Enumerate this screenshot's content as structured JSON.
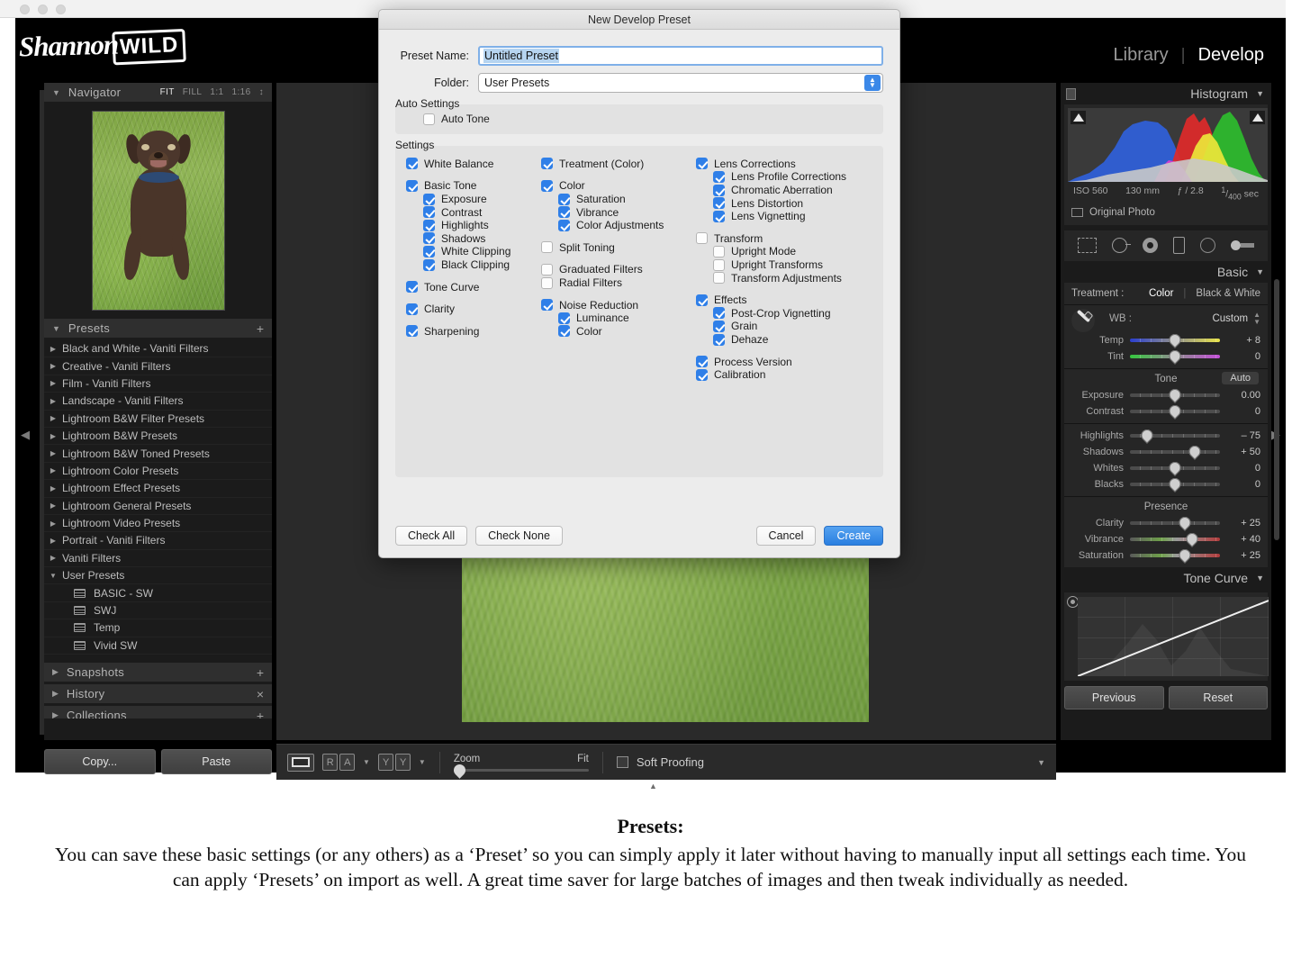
{
  "window": {
    "traffic_lights": [
      "close",
      "minimize",
      "zoom"
    ]
  },
  "app": {
    "brand_name": "Shannon",
    "brand_mark": "WILD",
    "modules": [
      {
        "label": "Library",
        "active": false
      },
      {
        "label": "Develop",
        "active": true
      }
    ],
    "module_separator": "|"
  },
  "navigator": {
    "title": "Navigator",
    "collapse_icon": "triangle-down-icon",
    "zoom_levels": [
      {
        "label": "FIT",
        "active": true
      },
      {
        "label": "FILL",
        "active": false
      },
      {
        "label": "1:1",
        "active": false
      },
      {
        "label": "1:16",
        "active": false
      }
    ],
    "stepper_icon": "stepper-icon"
  },
  "presets_panel": {
    "title": "Presets",
    "collapse_icon": "triangle-down-icon",
    "add_icon": "plus-icon",
    "items": [
      {
        "label": "Black and White - Vaniti Filters",
        "level": 0,
        "expanded": false
      },
      {
        "label": "Creative - Vaniti Filters",
        "level": 0,
        "expanded": false
      },
      {
        "label": "Film - Vaniti Filters",
        "level": 0,
        "expanded": false
      },
      {
        "label": "Landscape - Vaniti Filters",
        "level": 0,
        "expanded": false
      },
      {
        "label": "Lightroom B&W Filter Presets",
        "level": 0,
        "expanded": false
      },
      {
        "label": "Lightroom B&W Presets",
        "level": 0,
        "expanded": false
      },
      {
        "label": "Lightroom B&W Toned Presets",
        "level": 0,
        "expanded": false
      },
      {
        "label": "Lightroom Color Presets",
        "level": 0,
        "expanded": false
      },
      {
        "label": "Lightroom Effect Presets",
        "level": 0,
        "expanded": false
      },
      {
        "label": "Lightroom General Presets",
        "level": 0,
        "expanded": false
      },
      {
        "label": "Lightroom Video Presets",
        "level": 0,
        "expanded": false
      },
      {
        "label": "Portrait - Vaniti Filters",
        "level": 0,
        "expanded": false
      },
      {
        "label": "Vaniti Filters",
        "level": 0,
        "expanded": false
      },
      {
        "label": "User Presets",
        "level": 0,
        "expanded": true
      },
      {
        "label": "BASIC - SW",
        "level": 1,
        "expanded": false
      },
      {
        "label": "SWJ",
        "level": 1,
        "expanded": false
      },
      {
        "label": "Temp",
        "level": 1,
        "expanded": false
      },
      {
        "label": "Vivid SW",
        "level": 1,
        "expanded": false
      }
    ]
  },
  "snapshots_panel": {
    "title": "Snapshots",
    "collapse_icon": "triangle-right-icon",
    "add_icon": "plus-icon"
  },
  "history_panel": {
    "title": "History",
    "collapse_icon": "triangle-right-icon",
    "clear_icon": "close-icon"
  },
  "collections_panel": {
    "title": "Collections",
    "collapse_icon": "triangle-right-icon",
    "add_icon": "plus-icon"
  },
  "left_footer": {
    "copy_label": "Copy...",
    "paste_label": "Paste"
  },
  "toolbar": {
    "grid_icon": "loupe-view-icon",
    "compare_icon_a": "R",
    "compare_icon_b": "A",
    "compare_caret": "chevron-down-icon",
    "survey_icon_a": "Y",
    "survey_icon_b": "Y",
    "survey_caret": "chevron-down-icon",
    "zoom_label": "Zoom",
    "zoom_value": "Fit",
    "soft_proofing_label": "Soft Proofing",
    "soft_proofing_checked": false,
    "panel_caret": "chevron-down-icon"
  },
  "histogram_panel": {
    "title": "Histogram",
    "collapse_icon": "triangle-down-icon",
    "shadow_clipping_icon": "clipping-triangle-icon",
    "highlight_clipping_icon": "clipping-triangle-icon",
    "exif": {
      "iso": "ISO 560",
      "focal_length": "130 mm",
      "aperture": "ƒ / 2.8",
      "shutter_num": "1",
      "shutter_den": "400",
      "shutter_unit": "sec"
    },
    "original_photo_label": "Original Photo",
    "original_photo_checked": false
  },
  "tool_strip": {
    "tools": [
      {
        "name": "crop-overlay-icon",
        "active": false
      },
      {
        "name": "spot-removal-icon",
        "active": false
      },
      {
        "name": "red-eye-correction-icon",
        "active": false
      },
      {
        "name": "graduated-filter-icon",
        "active": false
      },
      {
        "name": "radial-filter-icon",
        "active": false
      },
      {
        "name": "adjustment-brush-icon",
        "active": false
      }
    ]
  },
  "basic_panel": {
    "title": "Basic",
    "collapse_icon": "triangle-down-icon",
    "treatment_label": "Treatment :",
    "treatment_options": [
      {
        "label": "Color",
        "active": true
      },
      {
        "label": "Black & White",
        "active": false
      }
    ],
    "eyedropper_icon": "white-balance-selector-icon",
    "wb_label": "WB :",
    "wb_value": "Custom",
    "wb_stepper_icon": "stepper-icon",
    "wb_sliders": [
      {
        "name": "Temp",
        "value": "+ 8",
        "pos": 50,
        "kind": "temp"
      },
      {
        "name": "Tint",
        "value": "0",
        "pos": 50,
        "kind": "tint"
      }
    ],
    "tone_title": "Tone",
    "auto_label": "Auto",
    "tone_sliders_a": [
      {
        "name": "Exposure",
        "value": "0.00",
        "pos": 50,
        "kind": "plain"
      },
      {
        "name": "Contrast",
        "value": "0",
        "pos": 50,
        "kind": "plain"
      }
    ],
    "tone_sliders_b": [
      {
        "name": "Highlights",
        "value": "– 75",
        "pos": 19,
        "kind": "plain"
      },
      {
        "name": "Shadows",
        "value": "+ 50",
        "pos": 72,
        "kind": "plain"
      },
      {
        "name": "Whites",
        "value": "0",
        "pos": 50,
        "kind": "plain"
      },
      {
        "name": "Blacks",
        "value": "0",
        "pos": 50,
        "kind": "plain"
      }
    ],
    "presence_title": "Presence",
    "presence_sliders": [
      {
        "name": "Clarity",
        "value": "+ 25",
        "pos": 61,
        "kind": "plain"
      },
      {
        "name": "Vibrance",
        "value": "+ 40",
        "pos": 69,
        "kind": "vib"
      },
      {
        "name": "Saturation",
        "value": "+ 25",
        "pos": 61,
        "kind": "sat"
      }
    ]
  },
  "tone_curve_panel": {
    "title": "Tone Curve",
    "collapse_icon": "triangle-down-icon",
    "point_curve_icon": "point-curve-icon",
    "target_adjust_icon": "target-adjustment-icon"
  },
  "right_footer": {
    "previous_label": "Previous",
    "reset_label": "Reset"
  },
  "dialog": {
    "title": "New Develop Preset",
    "preset_name_label": "Preset Name:",
    "preset_name_value": "Untitled Preset",
    "folder_label": "Folder:",
    "folder_value": "User Presets",
    "folder_stepper_icon": "stepper-icon",
    "auto_settings_legend": "Auto Settings",
    "auto_tone": {
      "label": "Auto Tone",
      "checked": false
    },
    "settings_legend": "Settings",
    "column_left": [
      {
        "label": "White Balance",
        "checked": true,
        "indent": 0
      },
      {
        "gap": true
      },
      {
        "label": "Basic Tone",
        "checked": true,
        "indent": 0
      },
      {
        "label": "Exposure",
        "checked": true,
        "indent": 1
      },
      {
        "label": "Contrast",
        "checked": true,
        "indent": 1
      },
      {
        "label": "Highlights",
        "checked": true,
        "indent": 1
      },
      {
        "label": "Shadows",
        "checked": true,
        "indent": 1
      },
      {
        "label": "White Clipping",
        "checked": true,
        "indent": 1
      },
      {
        "label": "Black Clipping",
        "checked": true,
        "indent": 1
      },
      {
        "gap": true
      },
      {
        "label": "Tone Curve",
        "checked": true,
        "indent": 0
      },
      {
        "gap": true
      },
      {
        "label": "Clarity",
        "checked": true,
        "indent": 0
      },
      {
        "gap": true
      },
      {
        "label": "Sharpening",
        "checked": true,
        "indent": 0
      }
    ],
    "column_middle": [
      {
        "label": "Treatment (Color)",
        "checked": true,
        "indent": 0
      },
      {
        "gap": true
      },
      {
        "label": "Color",
        "checked": true,
        "indent": 0
      },
      {
        "label": "Saturation",
        "checked": true,
        "indent": 1
      },
      {
        "label": "Vibrance",
        "checked": true,
        "indent": 1
      },
      {
        "label": "Color Adjustments",
        "checked": true,
        "indent": 1
      },
      {
        "gap": true
      },
      {
        "label": "Split Toning",
        "checked": false,
        "indent": 0
      },
      {
        "gap": true
      },
      {
        "label": "Graduated Filters",
        "checked": false,
        "indent": 0
      },
      {
        "label": "Radial Filters",
        "checked": false,
        "indent": 0
      },
      {
        "gap": true
      },
      {
        "label": "Noise Reduction",
        "checked": true,
        "indent": 0
      },
      {
        "label": "Luminance",
        "checked": true,
        "indent": 1
      },
      {
        "label": "Color",
        "checked": true,
        "indent": 1
      }
    ],
    "column_right": [
      {
        "label": "Lens Corrections",
        "checked": true,
        "indent": 0
      },
      {
        "label": "Lens Profile Corrections",
        "checked": true,
        "indent": 1
      },
      {
        "label": "Chromatic Aberration",
        "checked": true,
        "indent": 1
      },
      {
        "label": "Lens Distortion",
        "checked": true,
        "indent": 1
      },
      {
        "label": "Lens Vignetting",
        "checked": true,
        "indent": 1
      },
      {
        "gap": true
      },
      {
        "label": "Transform",
        "checked": false,
        "indent": 0
      },
      {
        "label": "Upright Mode",
        "checked": false,
        "indent": 1
      },
      {
        "label": "Upright Transforms",
        "checked": false,
        "indent": 1
      },
      {
        "label": "Transform Adjustments",
        "checked": false,
        "indent": 1
      },
      {
        "gap": true
      },
      {
        "label": "Effects",
        "checked": true,
        "indent": 0
      },
      {
        "label": "Post-Crop Vignetting",
        "checked": true,
        "indent": 1
      },
      {
        "label": "Grain",
        "checked": true,
        "indent": 1
      },
      {
        "label": "Dehaze",
        "checked": true,
        "indent": 1
      },
      {
        "gap": true
      },
      {
        "label": "Process Version",
        "checked": true,
        "indent": 0
      },
      {
        "label": "Calibration",
        "checked": true,
        "indent": 0
      }
    ],
    "check_all_label": "Check All",
    "check_none_label": "Check None",
    "cancel_label": "Cancel",
    "create_label": "Create"
  },
  "caption": {
    "title": "Presets:",
    "body": "You can save these basic settings (or any others) as a ‘Preset’ so you can simply apply it later without having to manually input all settings each time. You can apply ‘Presets’ on import as well.  A great time saver for large batches of images and then tweak individually as needed."
  }
}
